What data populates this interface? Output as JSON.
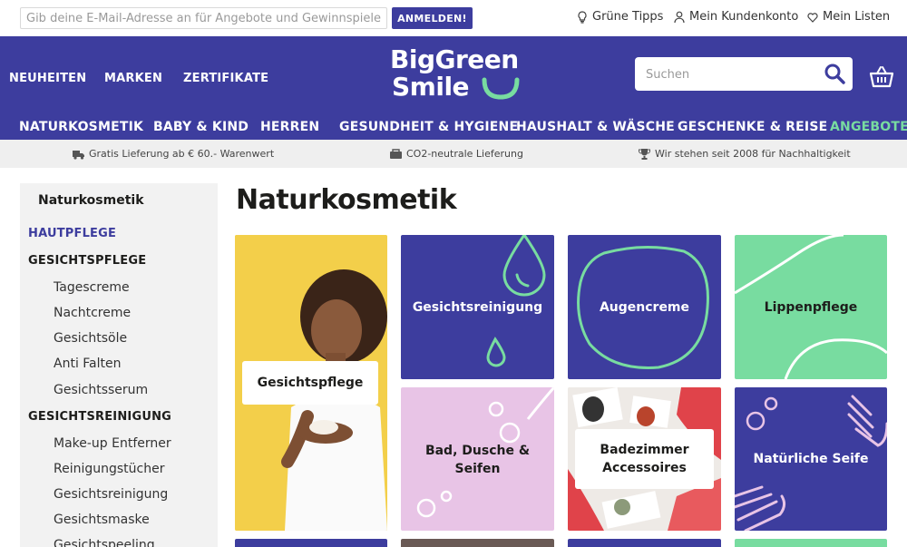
{
  "topbar": {
    "newsletter_placeholder": "Gib deine E-Mail-Adresse an für Angebote und Gewinnspiele",
    "newsletter_button": "ANMELDEN!",
    "links": [
      "Grüne Tipps",
      "Mein Kundenkonto",
      "Mein Listen"
    ]
  },
  "header": {
    "nav": [
      "NEUHEITEN",
      "MARKEN",
      "ZERTIFIKATE"
    ],
    "logo": {
      "line1": "BigGreen",
      "line2": "Smile"
    },
    "search_placeholder": "Suchen",
    "categories": [
      "NATURKOSMETIK",
      "BABY & KIND",
      "HERREN",
      "GESUNDHEIT & HYGIENE",
      "HAUSHALT & WÄSCHE",
      "GESCHENKE & REISE",
      "ANGEBOTE"
    ]
  },
  "usp": [
    "Gratis Lieferung ab € 60.- Warenwert",
    "CO2-neutrale Lieferung",
    "Wir stehen seit 2008 für Nachhaltigkeit"
  ],
  "sidebar": {
    "title": "Naturkosmetik",
    "active": "HAUTPFLEGE",
    "group1": "GESICHTSPFLEGE",
    "group1_items": [
      "Tagescreme",
      "Nachtcreme",
      "Gesichtsöle",
      "Anti Falten",
      "Gesichtsserum"
    ],
    "group2": "GESICHTSREINIGUNG",
    "group2_items": [
      "Make-up Entferner",
      "Reinigungstücher",
      "Gesichtsreinigung",
      "Gesichtsmaske",
      "Gesichtspeeling"
    ]
  },
  "main": {
    "title": "Naturkosmetik",
    "tiles": [
      "Gesichtspflege",
      "Gesichtsreinigung",
      "Augencreme",
      "Lippenpflege",
      "Bad, Dusche & Seifen",
      "Badezimmer Accessoires",
      "Natürliche Seife"
    ]
  },
  "colors": {
    "brand": "#3d3d9e",
    "accent_green": "#78dca0",
    "pink": "#e8c4e6",
    "yellow": "#f3cf4a"
  },
  "icons": [
    "lightbulb-icon",
    "user-icon",
    "heart-icon",
    "search-icon",
    "cart-icon",
    "truck-icon",
    "co2-icon",
    "trophy-icon"
  ]
}
